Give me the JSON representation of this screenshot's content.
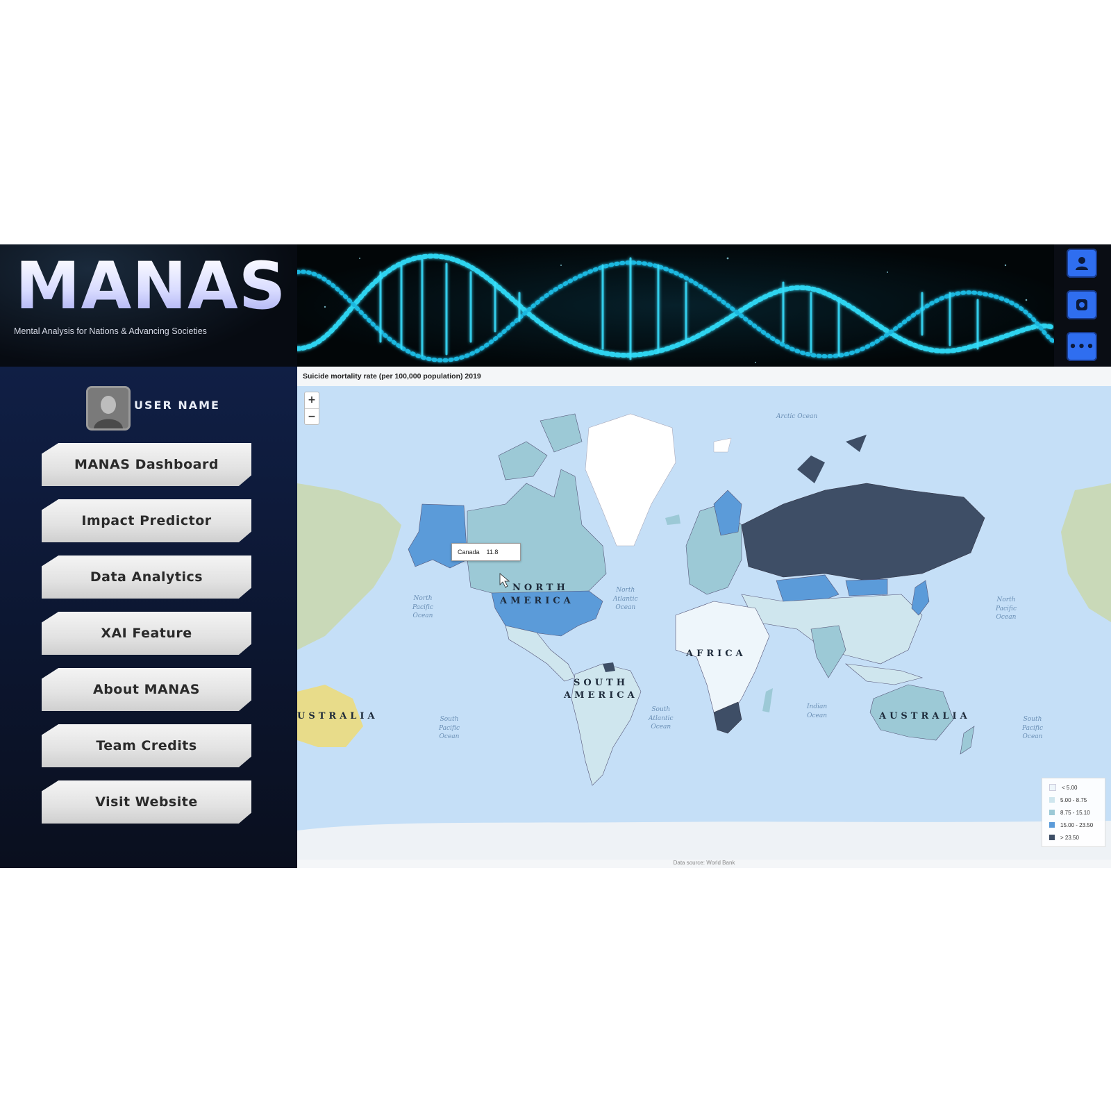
{
  "header": {
    "logo_title": "MANAS",
    "logo_subtitle": "Mental Analysis for Nations & Advancing Societies",
    "actions": [
      {
        "icon": "user-icon"
      },
      {
        "icon": "camera-icon"
      },
      {
        "icon": "more-icon",
        "label": "•••"
      }
    ],
    "accent_color": "#2f6ef0"
  },
  "sidebar": {
    "user_name": "USER NAME",
    "nav": [
      {
        "label": "MANAS Dashboard"
      },
      {
        "label": "Impact Predictor"
      },
      {
        "label": "Data Analytics"
      },
      {
        "label": "XAI Feature"
      },
      {
        "label": "About MANAS"
      },
      {
        "label": "Team Credits"
      },
      {
        "label": "Visit Website"
      }
    ]
  },
  "map": {
    "title": "Suicide mortality rate (per 100,000 population) 2019",
    "zoom_in": "+",
    "zoom_out": "−",
    "tooltip": {
      "country": "Canada",
      "value": "11.8"
    },
    "source": "Data source: World Bank",
    "oceans": {
      "arctic": "Arctic Ocean",
      "north_pacific": "North\nPacific\nOcean",
      "north_atlantic": "North\nAtlantic\nOcean",
      "south_pacific": "South\nPacific\nOcean",
      "south_atlantic": "South\nAtlantic\nOcean",
      "indian": "Indian\nOcean",
      "south_pacific_east": "South\nPacific\nOcean",
      "north_pacific_east": "North\nPacific\nOcean"
    },
    "continents": {
      "north_america_1": "NORTH",
      "north_america_2": "AMERICA",
      "south_america_1": "SOUTH",
      "south_america_2": "AMERICA",
      "africa": "AFRICA",
      "australia": "AUSTRALIA",
      "australia_west": "USTRALIA"
    },
    "legend": [
      {
        "label": "< 5.00",
        "color": "#eef6fb"
      },
      {
        "label": "5.00 - 8.75",
        "color": "#cfe6ee"
      },
      {
        "label": "8.75 - 15.10",
        "color": "#9cc9d6"
      },
      {
        "label": "15.00 - 23.50",
        "color": "#5b9bd9"
      },
      {
        "label": "> 23.50",
        "color": "#3e4e66"
      }
    ]
  }
}
